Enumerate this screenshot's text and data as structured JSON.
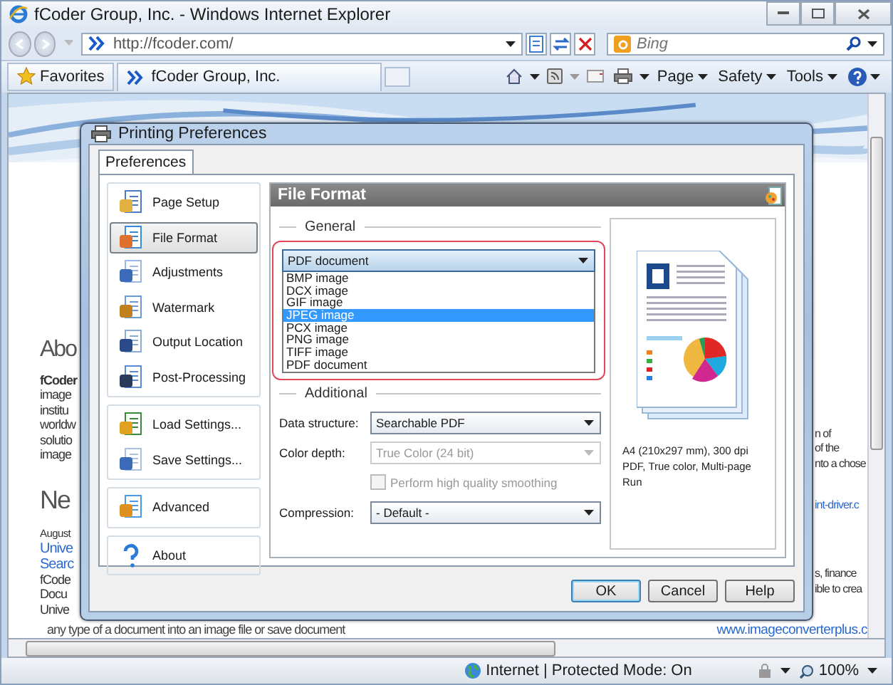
{
  "window": {
    "title": "fCoder Group, Inc. - Windows Internet Explorer"
  },
  "address_bar": {
    "url": "http://fcoder.com/",
    "search_placeholder": "Bing"
  },
  "favorites_bar": {
    "favorites": "Favorites",
    "tab_title": "fCoder Group, Inc.",
    "commands": [
      "Page",
      "Safety",
      "Tools"
    ]
  },
  "page": {
    "left_fragments": [
      {
        "kind": "heading",
        "text": "Abo"
      },
      {
        "kind": "bold",
        "text": "fCoder"
      },
      {
        "kind": "text",
        "text": "image"
      },
      {
        "kind": "text",
        "text": "institu"
      },
      {
        "kind": "text",
        "text": "worldw"
      },
      {
        "kind": "text",
        "text": "solutio"
      },
      {
        "kind": "text",
        "text": "image"
      },
      {
        "kind": "heading",
        "text": "Ne"
      },
      {
        "kind": "small",
        "text": "August"
      },
      {
        "kind": "link",
        "text": "Unive"
      },
      {
        "kind": "link",
        "text": "Searc"
      },
      {
        "kind": "text",
        "text": "fCode"
      },
      {
        "kind": "text",
        "text": "Docu"
      },
      {
        "kind": "text",
        "text": "Unive"
      }
    ],
    "bottom_line": "any type of a document into an image file or save document",
    "right_fragments": [
      {
        "kind": "text",
        "text": "n of"
      },
      {
        "kind": "text",
        "text": "of the"
      },
      {
        "kind": "text",
        "text": "nto a chose"
      },
      {
        "kind": "link",
        "text": "int-driver.c"
      },
      {
        "kind": "text",
        "text": "s, finance"
      },
      {
        "kind": "text",
        "text": "ible to crea"
      }
    ],
    "bottom_link": "www.imageconverterplus.c"
  },
  "dialog": {
    "title": "Printing Preferences",
    "tab": "Preferences",
    "nav_groups": [
      [
        {
          "label": "Page Setup",
          "selected": false
        },
        {
          "label": "File Format",
          "selected": true
        },
        {
          "label": "Adjustments",
          "selected": false
        },
        {
          "label": "Watermark",
          "selected": false
        },
        {
          "label": "Output Location",
          "selected": false
        },
        {
          "label": "Post-Processing",
          "selected": false
        }
      ],
      [
        {
          "label": "Load Settings...",
          "selected": false
        },
        {
          "label": "Save Settings...",
          "selected": false
        }
      ],
      [
        {
          "label": "Advanced",
          "selected": false
        }
      ],
      [
        {
          "label": "About",
          "selected": false
        }
      ]
    ],
    "panel_title": "File Format",
    "general_legend": "General",
    "format_value": "PDF document",
    "format_options": [
      {
        "label": "BMP image",
        "selected": false
      },
      {
        "label": "DCX image",
        "selected": false
      },
      {
        "label": "GIF image",
        "selected": false
      },
      {
        "label": "JPEG image",
        "selected": true
      },
      {
        "label": "PCX image",
        "selected": false
      },
      {
        "label": "PNG image",
        "selected": false
      },
      {
        "label": "TIFF image",
        "selected": false
      },
      {
        "label": "PDF document",
        "selected": false
      }
    ],
    "additional_legend": "Additional",
    "fields": [
      {
        "kind": "select",
        "label": "Data structure:",
        "value": "Searchable PDF",
        "disabled": false
      },
      {
        "kind": "select",
        "label": "Color depth:",
        "value": "True Color (24 bit)",
        "disabled": true
      },
      {
        "kind": "checkbox",
        "label": "Perform high quality smoothing",
        "checked": false,
        "disabled": true
      },
      {
        "kind": "select",
        "label": "Compression:",
        "value": "- Default -",
        "disabled": false
      }
    ],
    "preview_info": [
      "A4 (210x297 mm), 300 dpi",
      "PDF, True color, Multi-page",
      "Run"
    ],
    "buttons": [
      {
        "label": "OK",
        "default": true
      },
      {
        "label": "Cancel",
        "default": false
      },
      {
        "label": "Help",
        "default": false
      }
    ]
  },
  "status_bar": {
    "zone": "Internet | Protected Mode: On",
    "zoom": "100%"
  }
}
